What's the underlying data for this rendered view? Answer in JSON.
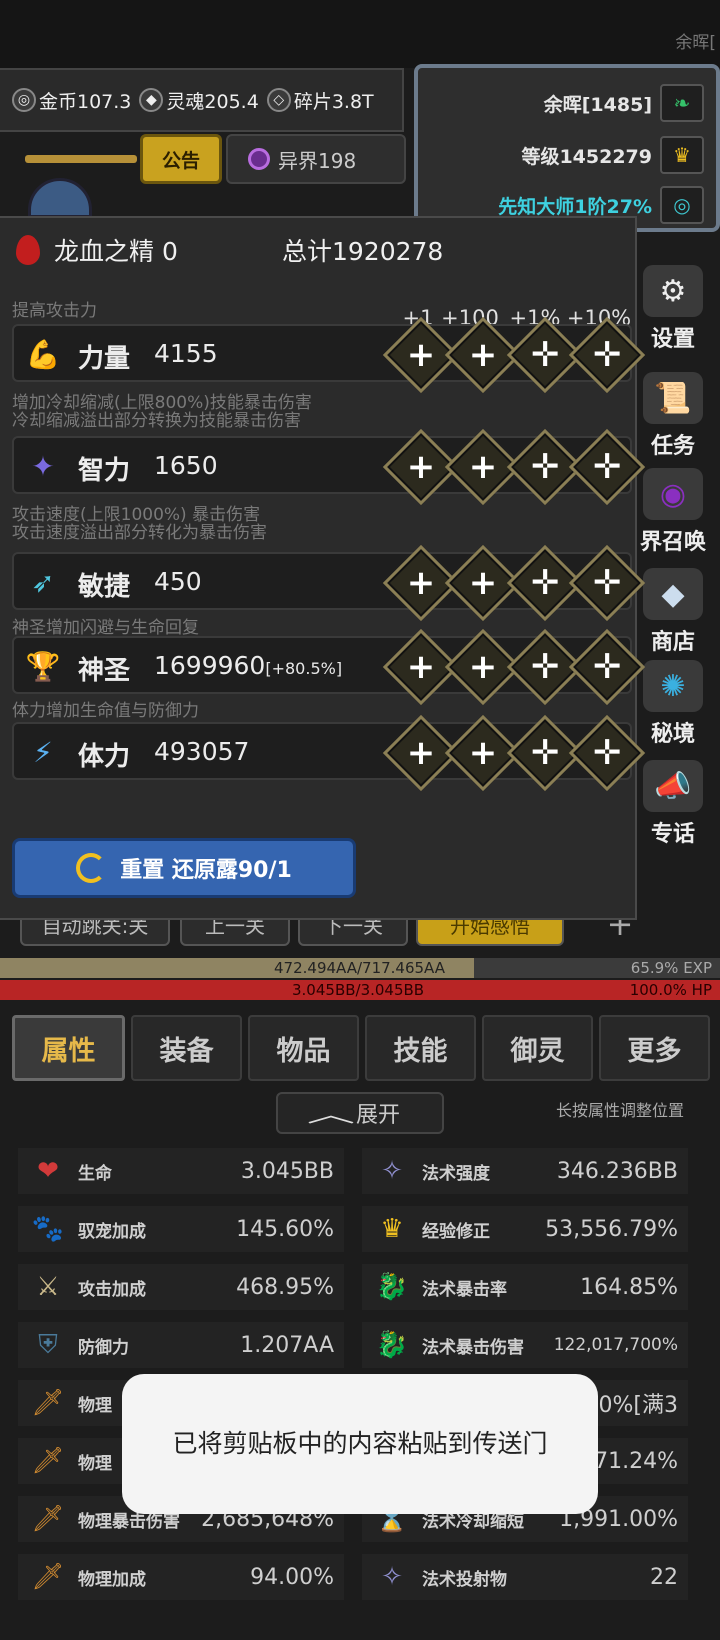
{
  "top": {
    "corner_text": "余晖["
  },
  "resources": [
    {
      "icon": "gold-icon",
      "label": "金币107.3"
    },
    {
      "icon": "soul-icon",
      "label": "灵魂205.4"
    },
    {
      "icon": "shard-icon",
      "label": "碎片3.8T"
    }
  ],
  "notice_button": "公告",
  "other_world": "异界198",
  "player": {
    "name": "余晖[1485]",
    "level": "等级1452279",
    "rank": "先知大师1阶27%"
  },
  "side_menu": [
    "设置",
    "任务",
    "界召唤",
    "商店",
    "秘境",
    "专话"
  ],
  "panel": {
    "title": "龙血之精 0",
    "total": "总计1920278",
    "increment_labels": [
      "+1",
      "+100",
      "+1%",
      "+10%"
    ],
    "stats": [
      {
        "desc": [
          "提高攻击力"
        ],
        "name": "力量",
        "value": "4155",
        "extra": "",
        "icon": "strength-icon"
      },
      {
        "desc": [
          "增加冷却缩减(上限800%)技能暴击伤害",
          "冷却缩减溢出部分转换为技能暴击伤害"
        ],
        "name": "智力",
        "value": "1650",
        "extra": "",
        "icon": "intelligence-icon"
      },
      {
        "desc": [
          "攻击速度(上限1000%) 暴击伤害",
          "攻击速度溢出部分转化为暴击伤害"
        ],
        "name": "敏捷",
        "value": "450",
        "extra": "",
        "icon": "agility-icon"
      },
      {
        "desc": [
          "神圣增加闪避与生命回复"
        ],
        "name": "神圣",
        "value": "1699960",
        "extra": "[+80.5%]",
        "icon": "holy-icon"
      },
      {
        "desc": [
          "体力增加生命值与防御力"
        ],
        "name": "体力",
        "value": "493057",
        "extra": "",
        "icon": "stamina-icon"
      }
    ],
    "reset_button": "重置 还原露90/1"
  },
  "under_buttons": [
    "自动跳关:关",
    "上一关",
    "下一关",
    "开始感悟",
    "+"
  ],
  "exp_bar": {
    "text": "472.494AA/717.465AA",
    "percent_text": "65.9%  EXP",
    "fraction": 0.659
  },
  "hp_bar": {
    "text": "3.045BB/3.045BB",
    "percent_text": "100.0%  HP"
  },
  "tabs": [
    "属性",
    "装备",
    "物品",
    "技能",
    "御灵",
    "更多"
  ],
  "expand_label": "展开",
  "hint": "长按属性调整位置",
  "attributes_left": [
    {
      "icon": "heart-icon",
      "label": "生命",
      "value": "3.045BB"
    },
    {
      "icon": "paw-icon",
      "label": "驭宠加成",
      "value": "145.60%"
    },
    {
      "icon": "crossed-swords-icon",
      "label": "攻击加成",
      "value": "468.95%"
    },
    {
      "icon": "shield-icon",
      "label": "防御力",
      "value": "1.207AA"
    },
    {
      "icon": "sword-icon",
      "label": "物理",
      "value": ""
    },
    {
      "icon": "sword-icon",
      "label": "物理",
      "value": ""
    },
    {
      "icon": "sword-icon",
      "label": "物理暴击伤害",
      "value": "2,685,648%"
    },
    {
      "icon": "sword-icon",
      "label": "物理加成",
      "value": "94.00%"
    }
  ],
  "attributes_right": [
    {
      "icon": "spell-icon",
      "label": "法术强度",
      "value": "346.236BB"
    },
    {
      "icon": "crown-icon",
      "label": "经验修正",
      "value": "53,556.79%"
    },
    {
      "icon": "dragon-icon",
      "label": "法术暴击率",
      "value": "164.85%"
    },
    {
      "icon": "dragon-icon",
      "label": "法术暴击伤害",
      "value": "122,017,700%"
    },
    {
      "icon": "spell-icon",
      "label": "",
      "value": "0%[满3"
    },
    {
      "icon": "spell-icon",
      "label": "",
      "value": "71.24%"
    },
    {
      "icon": "hourglass-icon",
      "label": "法术冷却缩短",
      "value": "1,991.00%"
    },
    {
      "icon": "spell-icon",
      "label": "法术投射物",
      "value": "22"
    }
  ],
  "toast": "已将剪贴板中的内容粘贴到传送门"
}
